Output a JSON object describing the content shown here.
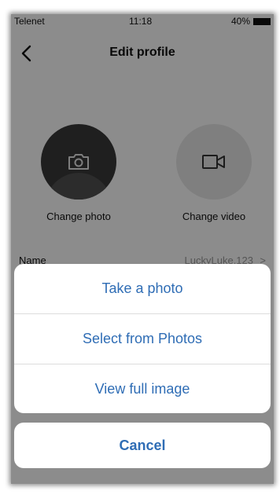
{
  "status_bar": {
    "carrier": "Telenet",
    "time": "11:18",
    "battery": "40%"
  },
  "nav": {
    "title": "Edit profile",
    "back_icon": "chevron-left-icon"
  },
  "media": {
    "photo_label": "Change photo",
    "photo_icon": "camera-icon",
    "video_label": "Change video",
    "video_icon": "video-camera-icon"
  },
  "profile_row": {
    "label": "Name",
    "value": "LuckyLuke.123",
    "chevron": ">"
  },
  "action_sheet": {
    "actions": [
      {
        "label": "Take a photo"
      },
      {
        "label": "Select from Photos"
      },
      {
        "label": "View full image"
      }
    ],
    "cancel_label": "Cancel",
    "accent_color": "#2f6db5"
  }
}
